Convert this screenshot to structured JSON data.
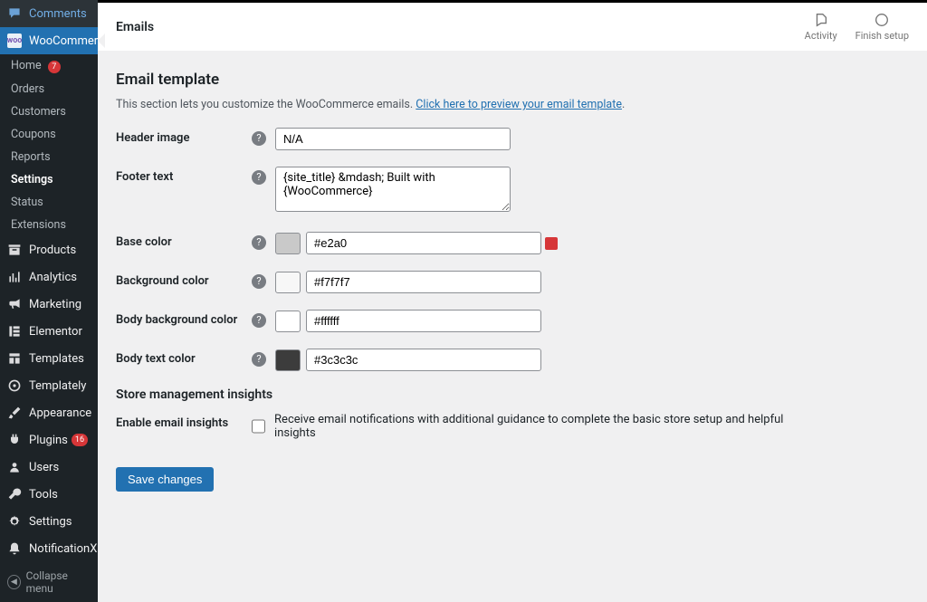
{
  "sidebar": {
    "comments": "Comments",
    "woocommerce": "WooCommerce",
    "sub": {
      "home": "Home",
      "home_badge": "7",
      "orders": "Orders",
      "customers": "Customers",
      "coupons": "Coupons",
      "reports": "Reports",
      "settings": "Settings",
      "status": "Status",
      "extensions": "Extensions"
    },
    "products": "Products",
    "analytics": "Analytics",
    "marketing": "Marketing",
    "elementor": "Elementor",
    "templates": "Templates",
    "templately": "Templately",
    "appearance": "Appearance",
    "plugins": "Plugins",
    "plugins_badge": "16",
    "users": "Users",
    "tools": "Tools",
    "wp_settings": "Settings",
    "notificationx": "NotificationX",
    "collapse": "Collapse menu"
  },
  "topbar": {
    "title": "Emails",
    "activity": "Activity",
    "finish": "Finish setup"
  },
  "template": {
    "heading": "Email template",
    "desc_prefix": "This section lets you customize the WooCommerce emails. ",
    "desc_link": "Click here to preview your email template",
    "header_image_label": "Header image",
    "header_image_value": "N/A",
    "footer_text_label": "Footer text",
    "footer_text_value": "{site_title} &mdash; Built with {WooCommerce}",
    "base_color_label": "Base color",
    "base_color_value": "#e2a0",
    "base_color_swatch": "#c9c9c9",
    "bg_color_label": "Background color",
    "bg_color_value": "#f7f7f7",
    "body_bg_label": "Body background color",
    "body_bg_value": "#ffffff",
    "body_text_label": "Body text color",
    "body_text_value": "#3c3c3c"
  },
  "insights": {
    "heading": "Store management insights",
    "enable_label": "Enable email insights",
    "enable_desc": "Receive email notifications with additional guidance to complete the basic store setup and helpful insights"
  },
  "save": "Save changes",
  "help_icon": "?"
}
